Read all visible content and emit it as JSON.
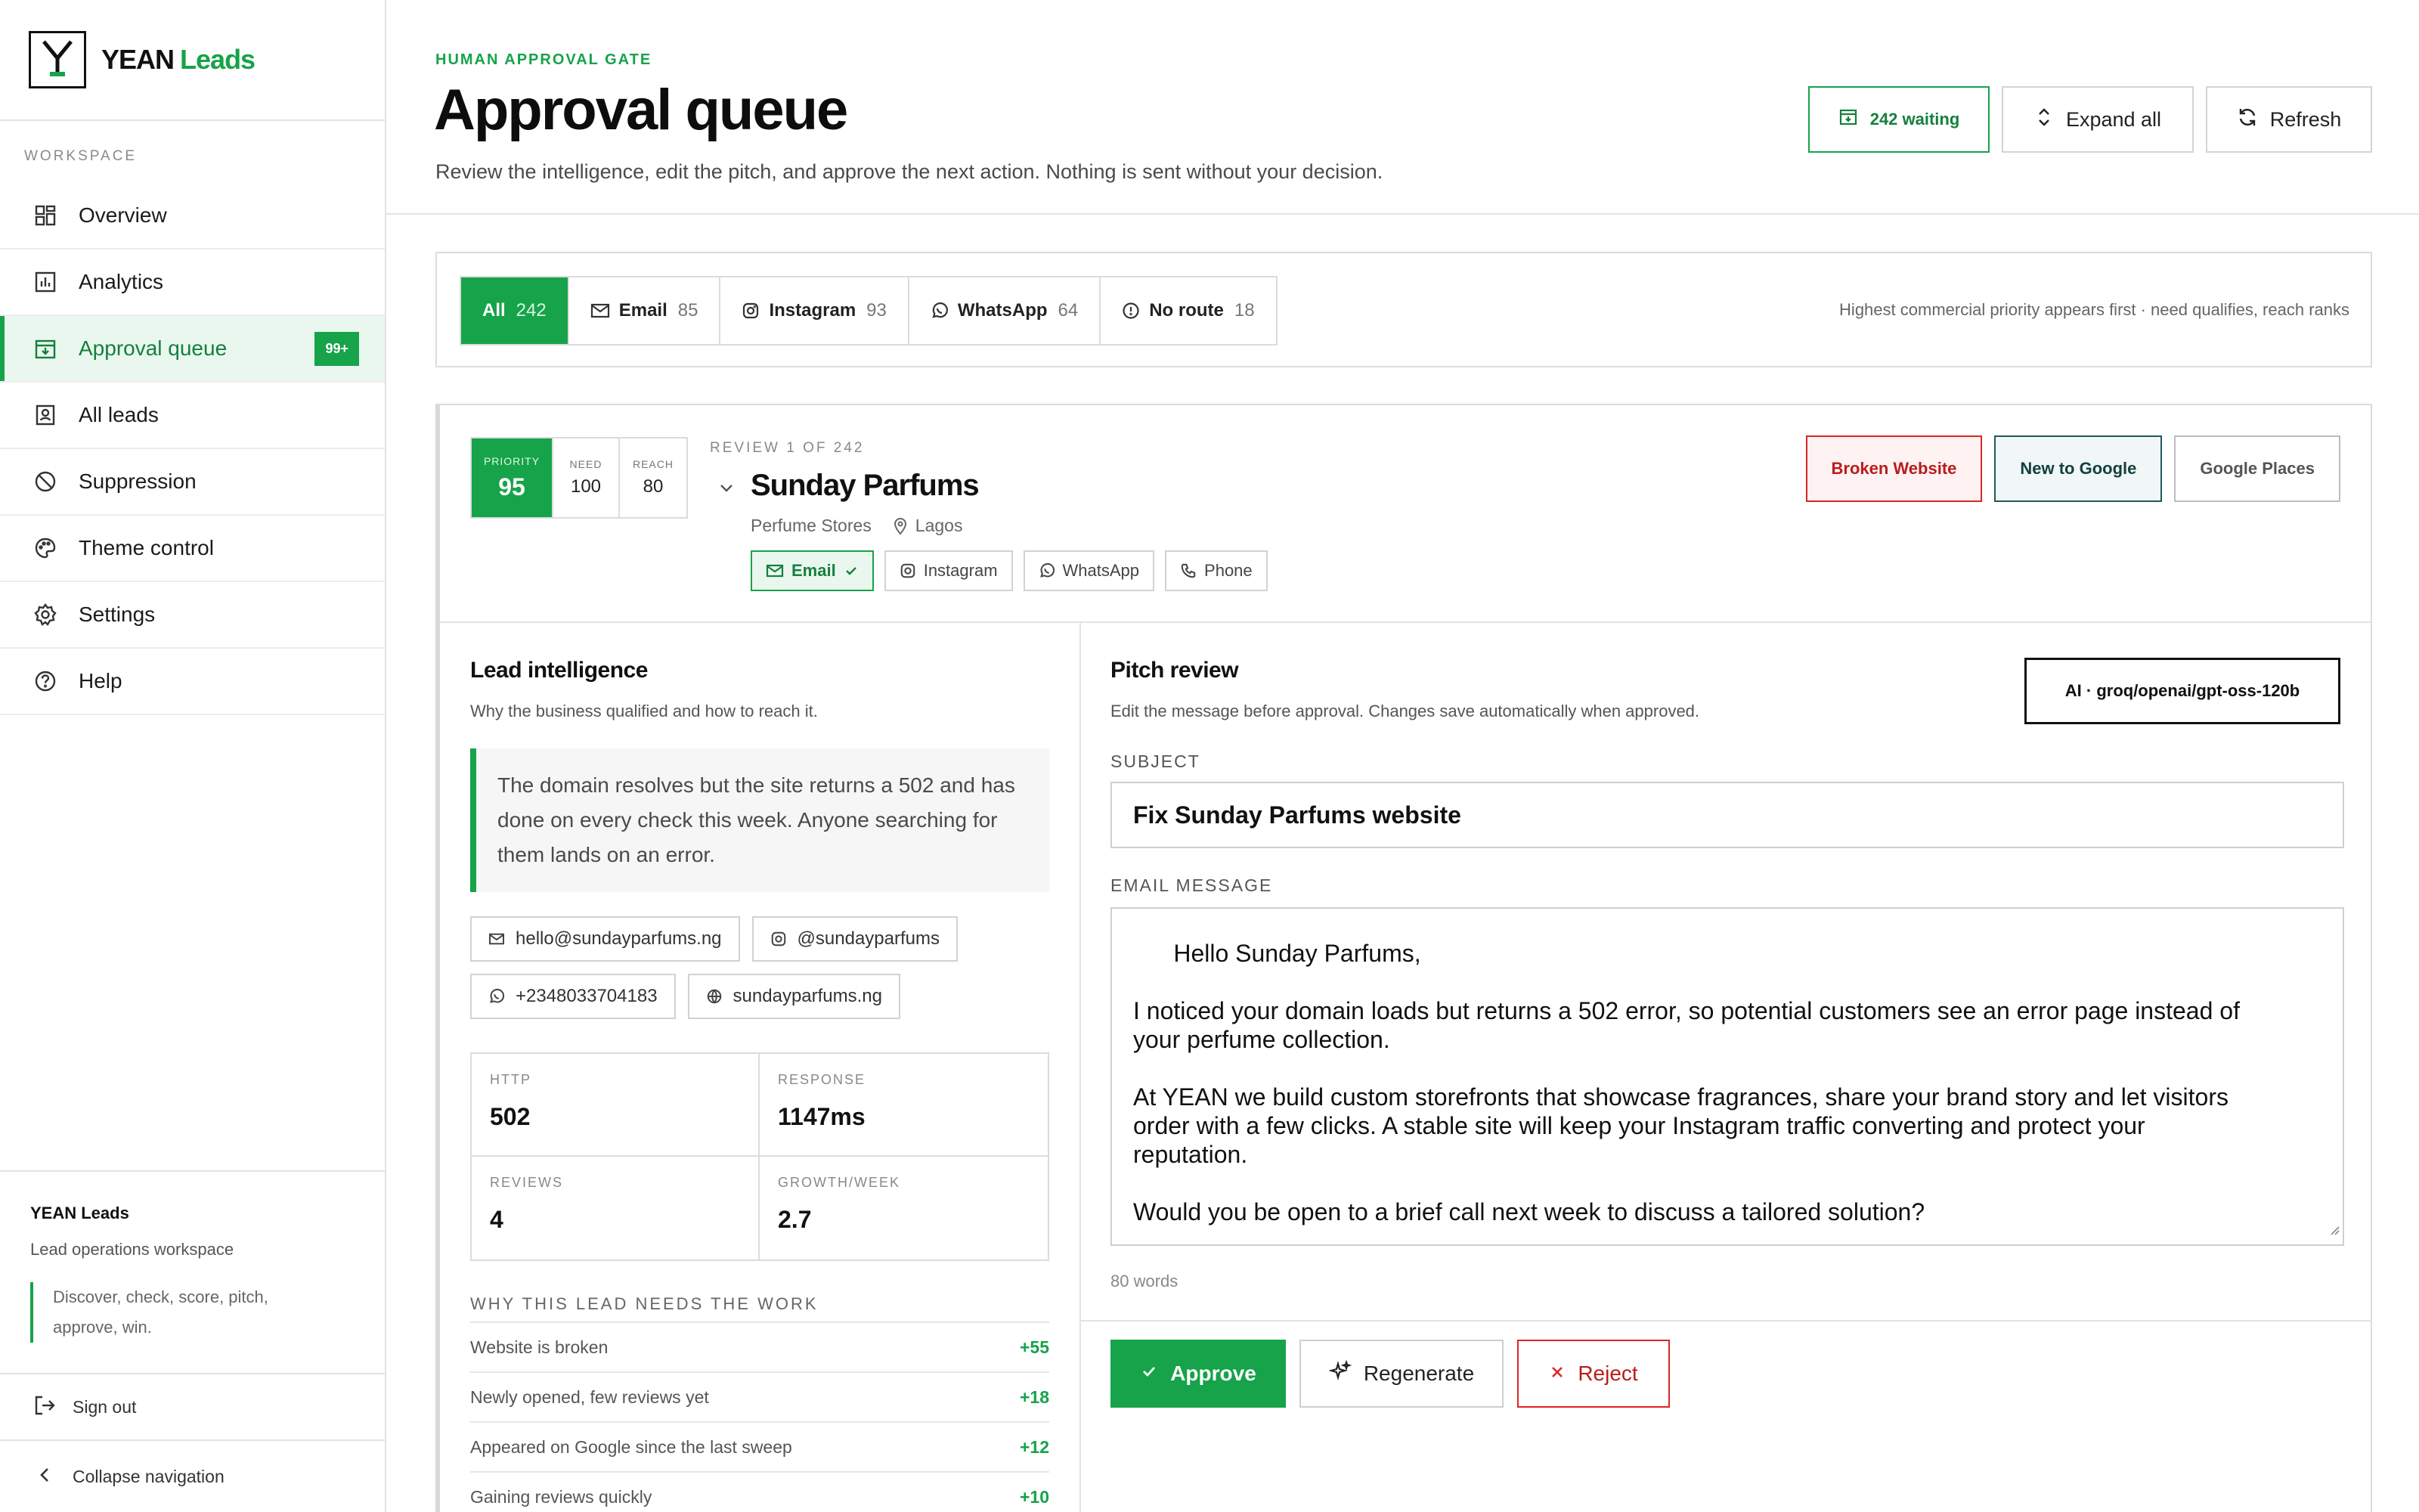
{
  "app": {
    "name_main": "YEAN",
    "name_accent": "Leads",
    "logo_letter": "Y"
  },
  "sidebar": {
    "section_label": "WORKSPACE",
    "items": [
      {
        "label": "Overview",
        "icon": "grid-icon"
      },
      {
        "label": "Analytics",
        "icon": "bar-chart-icon"
      },
      {
        "label": "Approval queue",
        "icon": "inbox-icon",
        "badge": "99+",
        "active": true
      },
      {
        "label": "All leads",
        "icon": "contacts-icon"
      },
      {
        "label": "Suppression",
        "icon": "ban-icon"
      },
      {
        "label": "Theme control",
        "icon": "palette-icon"
      },
      {
        "label": "Settings",
        "icon": "gear-icon"
      },
      {
        "label": "Help",
        "icon": "help-circle-icon"
      }
    ],
    "footer": {
      "title": "YEAN Leads",
      "subtitle": "Lead operations workspace",
      "tagline": "Discover, check, score, pitch, approve, win."
    },
    "sign_out": "Sign out",
    "collapse": "Collapse navigation"
  },
  "header": {
    "eyebrow": "HUMAN APPROVAL GATE",
    "title": "Approval queue",
    "subtitle": "Review the intelligence, edit the pitch, and approve the next action. Nothing is sent without your decision.",
    "waiting": "242 waiting",
    "expand_all": "Expand all",
    "refresh": "Refresh"
  },
  "filters": {
    "tabs": [
      {
        "label": "All",
        "count": "242",
        "active": true
      },
      {
        "label": "Email",
        "count": "85",
        "icon": "mail-icon"
      },
      {
        "label": "Instagram",
        "count": "93",
        "icon": "instagram-icon"
      },
      {
        "label": "WhatsApp",
        "count": "64",
        "icon": "whatsapp-icon"
      },
      {
        "label": "No route",
        "count": "18",
        "icon": "alert-circle-icon"
      }
    ],
    "hint": "Highest commercial priority appears first · need qualifies, reach ranks"
  },
  "lead": {
    "priority_label": "PRIORITY",
    "priority": "95",
    "need_label": "NEED",
    "need": "100",
    "reach_label": "REACH",
    "reach": "80",
    "review_of": "REVIEW 1 OF 242",
    "name": "Sunday Parfums",
    "category": "Perfume Stores",
    "location": "Lagos",
    "channels": [
      "Email",
      "Instagram",
      "WhatsApp",
      "Phone"
    ],
    "tags": [
      "Broken Website",
      "New to Google",
      "Google Places"
    ]
  },
  "intelligence": {
    "title": "Lead intelligence",
    "subtitle": "Why the business qualified and how to reach it.",
    "insight": "The domain resolves but the site returns a 502 and has done on every check this week. Anyone searching for them lands on an error.",
    "contacts": {
      "email": "hello@sundayparfums.ng",
      "instagram": "@sundayparfums",
      "phone": "+2348033704183",
      "website": "sundayparfums.ng"
    },
    "metrics": [
      {
        "label": "HTTP",
        "value": "502"
      },
      {
        "label": "RESPONSE",
        "value": "1147ms"
      },
      {
        "label": "REVIEWS",
        "value": "4"
      },
      {
        "label": "GROWTH/WEEK",
        "value": "2.7"
      }
    ],
    "why_title": "WHY THIS LEAD NEEDS THE WORK",
    "why": [
      {
        "reason": "Website is broken",
        "points": "+55"
      },
      {
        "reason": "Newly opened, few reviews yet",
        "points": "+18"
      },
      {
        "reason": "Appeared on Google since the last sweep",
        "points": "+12"
      },
      {
        "reason": "Gaining reviews quickly",
        "points": "+10"
      }
    ]
  },
  "pitch": {
    "title": "Pitch review",
    "subtitle": "Edit the message before approval. Changes save automatically when approved.",
    "ai_model": "AI · groq/openai/gpt-oss-120b",
    "subject_label": "SUBJECT",
    "subject": "Fix Sunday Parfums website",
    "message_label": "EMAIL MESSAGE",
    "message": "Hello Sunday Parfums,\n\nI noticed your domain loads but returns a 502 error, so potential customers see an error page instead of\nyour perfume collection.\n\nAt YEAN we build custom storefronts that showcase fragrances, share your brand story and let visitors\norder with a few clicks. A stable site will keep your Instagram traffic converting and protect your\nreputation.\n\nWould you be open to a brief call next week to discuss a tailored solution?\n\nKind regards,",
    "word_count": "80 words",
    "approve": "Approve",
    "regenerate": "Regenerate",
    "reject": "Reject"
  },
  "colors": {
    "accent": "#16a34a",
    "danger": "#dc2626",
    "teal": "#1f5a5a"
  }
}
